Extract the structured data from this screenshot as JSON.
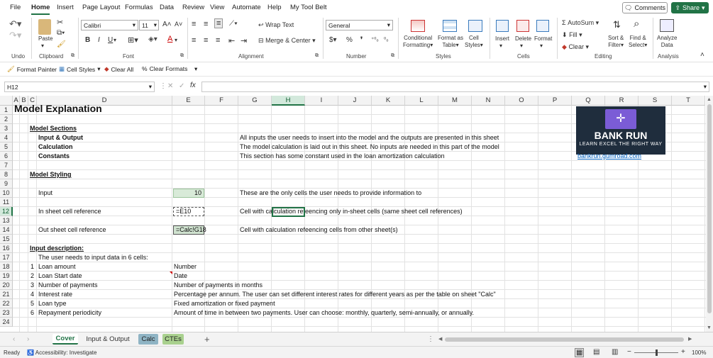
{
  "menu": {
    "items": [
      "File",
      "Home",
      "Insert",
      "Page Layout",
      "Formulas",
      "Data",
      "Review",
      "View",
      "Automate",
      "Help",
      "My Tool Belt"
    ],
    "active": "Home",
    "comments": "Comments",
    "share": "Share"
  },
  "ribbon": {
    "undo_label": "Undo",
    "clipboard": {
      "paste": "Paste",
      "label": "Clipboard"
    },
    "font": {
      "name": "Calibri",
      "size": "11",
      "label": "Font",
      "bold": "B",
      "italic": "I",
      "underline": "U"
    },
    "alignment": {
      "wrap": "Wrap Text",
      "merge": "Merge & Center",
      "label": "Alignment"
    },
    "number": {
      "format": "General",
      "label": "Number"
    },
    "styles": {
      "conditional": [
        "Conditional",
        "Formatting"
      ],
      "format_table": [
        "Format as",
        "Table"
      ],
      "cell_styles": [
        "Cell",
        "Styles"
      ],
      "label": "Styles"
    },
    "cells": {
      "insert": "Insert",
      "delete": "Delete",
      "format": "Format",
      "label": "Cells"
    },
    "editing": {
      "autosum": "AutoSum",
      "fill": "Fill",
      "clear": "Clear",
      "sort": [
        "Sort &",
        "Filter"
      ],
      "find": [
        "Find &",
        "Select"
      ],
      "label": "Editing"
    },
    "analysis": {
      "analyze": [
        "Analyze",
        "Data"
      ],
      "label": "Analysis"
    }
  },
  "qab": {
    "format_painter": "Format Painter",
    "cell_styles": "Cell Styles",
    "clear_all": "Clear All",
    "clear_formats": "Clear Formats"
  },
  "formula_bar": {
    "name_box": "H12",
    "fx": "fx",
    "formula": ""
  },
  "columns": [
    "A",
    "B",
    "C",
    "D",
    "E",
    "F",
    "G",
    "H",
    "I",
    "J",
    "K",
    "L",
    "M",
    "N",
    "O",
    "P",
    "Q",
    "R",
    "S",
    "T"
  ],
  "selected_column": "H",
  "rows": [
    "1",
    "2",
    "3",
    "4",
    "5",
    "6",
    "7",
    "8",
    "9",
    "10",
    "11",
    "12",
    "13",
    "14",
    "15",
    "16",
    "17",
    "18",
    "19",
    "20",
    "21",
    "22",
    "23",
    "24"
  ],
  "selected_row": "12",
  "sheet": {
    "title": "Model Explanation",
    "sections_header": "Model Sections",
    "sections": [
      {
        "name": "Input & Output",
        "desc": "All inputs the user needs to insert into the model and the outputs are presented in this sheet"
      },
      {
        "name": "Calculation",
        "desc": "The model calculation is laid out in this sheet. No inputs are needed in this part of the model"
      },
      {
        "name": "Constants",
        "desc": "This section has some constant used in the loan amortization calculation"
      }
    ],
    "styling_header": "Model Styling",
    "styling": [
      {
        "label": "Input",
        "sample": "10",
        "desc": "These are the only cells the user needs to provide information to"
      },
      {
        "label": "In sheet cell reference",
        "sample": "=E10",
        "desc": "Cell with calculation refeencing only in-sheet cells (same sheet cell references)"
      },
      {
        "label": "Out sheet cell reference",
        "sample": "=Calc!G18",
        "desc": "Cell with calculation refeencing cells from other sheet(s)"
      }
    ],
    "input_header": "Input description:",
    "input_intro": "The user needs to input data in 6 cells:",
    "inputs": [
      {
        "n": "1",
        "name": "Loan amount",
        "desc": "Number"
      },
      {
        "n": "2",
        "name": "Loan Start date",
        "desc": "Date"
      },
      {
        "n": "3",
        "name": "Number of payments",
        "desc": "Number of payments in months"
      },
      {
        "n": "4",
        "name": "Interest rate",
        "desc": "Percentage per annum. The user can set different interest rates for different years as per the table on sheet \"Calc\""
      },
      {
        "n": "5",
        "name": "Loan type",
        "desc": "Fixed amortization or fixed payment"
      },
      {
        "n": "6",
        "name": "Repayment periodicity",
        "desc": "Amount of time in between two payments. User can choose: monthly, quarterly, semi-annually, or annually."
      }
    ],
    "logo": {
      "brand": "BANK RUN",
      "tagline": "LEARN EXCEL THE RIGHT WAY",
      "link": "bankrun.gumroad.com"
    }
  },
  "tabs": [
    {
      "label": "Cover",
      "active": true,
      "color": ""
    },
    {
      "label": "Input & Output",
      "active": false,
      "color": ""
    },
    {
      "label": "Calc",
      "active": false,
      "color": "#8fb4c4"
    },
    {
      "label": "CTEs",
      "active": false,
      "color": "#a9d18e"
    }
  ],
  "status": {
    "ready": "Ready",
    "accessibility": "Accessibility: Investigate",
    "zoom": "100%"
  },
  "colors": {
    "accent": "#217346",
    "input_fill": "#d8ead8",
    "outref_fill": "#d0e3d0",
    "logo_bg": "#1f2d3d",
    "logo_icon": "#7b5cd6"
  }
}
